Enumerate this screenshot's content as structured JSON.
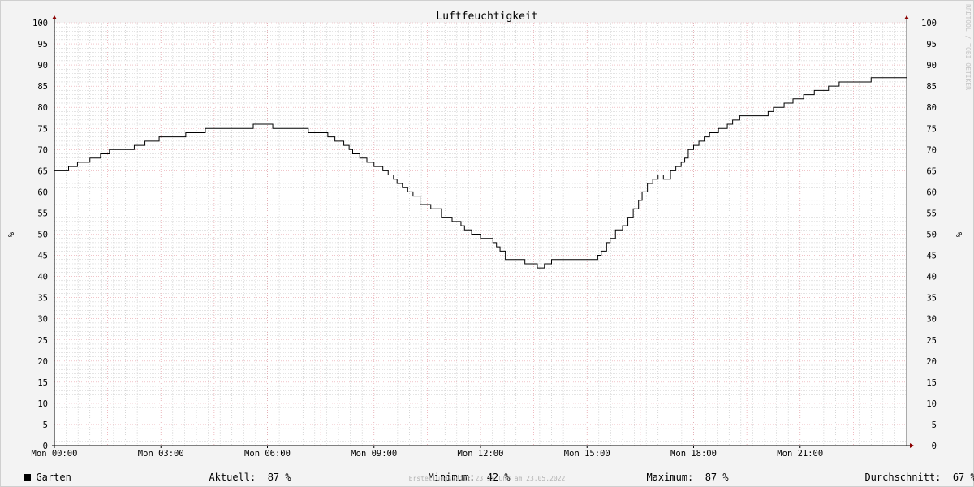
{
  "watermark": "RRDTOOL / TOBI OETIKER",
  "footer": "Erstellungszeit: 23:55 Uhr am 23.05.2022",
  "legend": {
    "series_label": "Garten",
    "current_label": "Aktuell:",
    "current_value": "87 %",
    "min_label": "Minimum:",
    "min_value": "42 %",
    "max_label": "Maximum:",
    "max_value": "87 %",
    "avg_label": "Durchschnitt:",
    "avg_value": "67 %"
  },
  "colors": {
    "line": "#000000",
    "major_grid": "#e8a0a8",
    "minor_grid": "#c8c8c8",
    "arrow": "#8b0000",
    "background": "#f3f3f3",
    "plot_background": "#ffffff"
  },
  "chart_data": {
    "type": "line",
    "title": "Luftfeuchtigkeit",
    "ylabel": "%",
    "ylim": [
      0,
      100
    ],
    "y_ticks": [
      0,
      5,
      10,
      15,
      20,
      25,
      30,
      35,
      40,
      45,
      50,
      55,
      60,
      65,
      70,
      75,
      80,
      85,
      90,
      95,
      100
    ],
    "xlim": [
      0,
      24
    ],
    "x_tick_hours": [
      0,
      3,
      6,
      9,
      12,
      15,
      18,
      21
    ],
    "x_tick_labels": [
      "Mon 00:00",
      "Mon 03:00",
      "Mon 06:00",
      "Mon 09:00",
      "Mon 12:00",
      "Mon 15:00",
      "Mon 18:00",
      "Mon 21:00"
    ],
    "grid": true,
    "legend_position": "bottom",
    "series": [
      {
        "name": "Garten",
        "step": true,
        "x": [
          0.0,
          0.4,
          0.65,
          1.0,
          1.3,
          1.55,
          1.95,
          2.25,
          2.55,
          2.95,
          3.3,
          3.7,
          4.1,
          4.25,
          4.9,
          5.6,
          5.85,
          6.15,
          6.35,
          6.95,
          7.15,
          7.7,
          7.9,
          8.15,
          8.3,
          8.4,
          8.6,
          8.8,
          9.0,
          9.25,
          9.4,
          9.55,
          9.65,
          9.8,
          9.95,
          10.1,
          10.3,
          10.6,
          10.9,
          11.2,
          11.45,
          11.55,
          11.75,
          12.0,
          12.35,
          12.45,
          12.55,
          12.7,
          13.25,
          13.45,
          13.6,
          13.8,
          14.0,
          14.45,
          14.8,
          15.05,
          15.3,
          15.4,
          15.55,
          15.65,
          15.8,
          16.0,
          16.15,
          16.3,
          16.45,
          16.55,
          16.7,
          16.85,
          17.0,
          17.15,
          17.35,
          17.5,
          17.65,
          17.75,
          17.85,
          18.0,
          18.15,
          18.3,
          18.45,
          18.7,
          18.95,
          19.1,
          19.3,
          19.5,
          19.75,
          20.1,
          20.25,
          20.55,
          20.8,
          21.1,
          21.4,
          21.8,
          22.1,
          22.6,
          23.0,
          24.0
        ],
        "values": [
          65,
          66,
          67,
          68,
          69,
          70,
          70,
          71,
          72,
          73,
          73,
          74,
          74,
          75,
          75,
          76,
          76,
          75,
          75,
          75,
          74,
          73,
          72,
          71,
          70,
          69,
          68,
          67,
          66,
          65,
          64,
          63,
          62,
          61,
          60,
          59,
          57,
          56,
          54,
          53,
          52,
          51,
          50,
          49,
          48,
          47,
          46,
          44,
          43,
          43,
          42,
          43,
          44,
          44,
          44,
          44,
          45,
          46,
          48,
          49,
          51,
          52,
          54,
          56,
          58,
          60,
          62,
          63,
          64,
          63,
          65,
          66,
          67,
          68,
          70,
          71,
          72,
          73,
          74,
          75,
          76,
          77,
          78,
          78,
          78,
          79,
          80,
          81,
          82,
          83,
          84,
          85,
          86,
          86,
          87,
          87
        ]
      }
    ]
  }
}
